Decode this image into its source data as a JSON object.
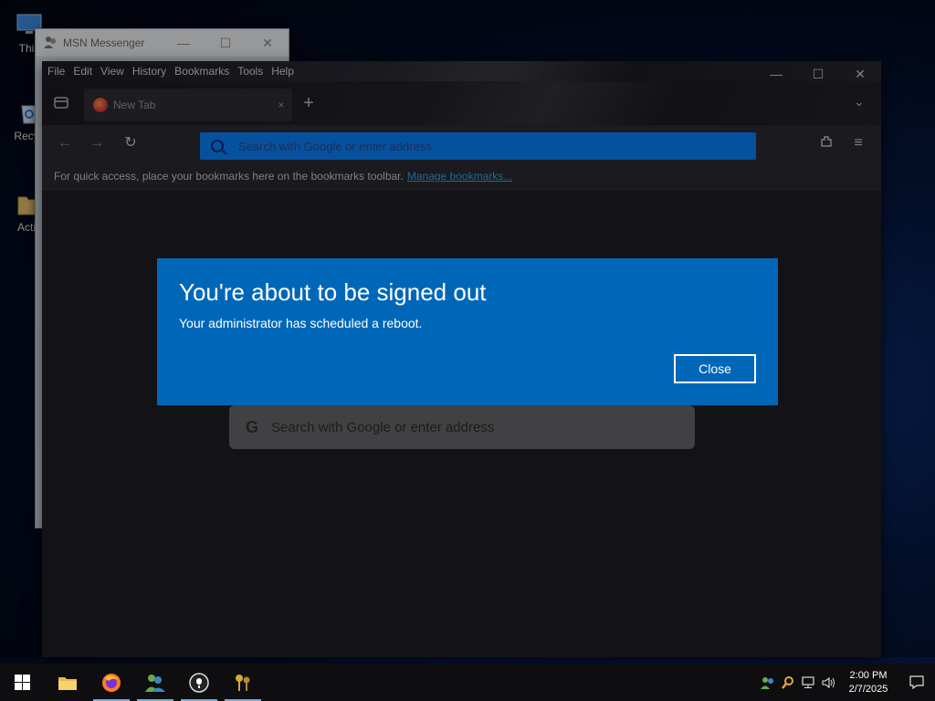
{
  "desktop": {
    "icons": [
      {
        "label": "This",
        "icon": "monitor-icon"
      },
      {
        "label": "Recyc",
        "icon": "recycle-bin-icon"
      },
      {
        "label": "Activ",
        "icon": "folder-icon"
      }
    ]
  },
  "msn_window": {
    "title": "MSN Messenger",
    "controls": {
      "minimize": "—",
      "maximize": "☐",
      "close": "✕"
    }
  },
  "firefox": {
    "menu": [
      "File",
      "Edit",
      "View",
      "History",
      "Bookmarks",
      "Tools",
      "Help"
    ],
    "tab": {
      "label": "New Tab",
      "close": "×"
    },
    "new_tab_plus": "+",
    "url_placeholder": "Search with Google or enter address",
    "bookmarks_bar": {
      "text": "For quick access, place your bookmarks here on the bookmarks toolbar.",
      "link": "Manage bookmarks..."
    },
    "content_search": {
      "g": "G",
      "placeholder": "Search with Google or enter address"
    }
  },
  "dialog": {
    "title": "You're about to be signed out",
    "message": "Your administrator has scheduled a reboot.",
    "close_label": "Close"
  },
  "taskbar": {
    "apps": [
      "file-explorer-icon",
      "firefox-icon",
      "msn-messenger-icon",
      "lightbulb-app-icon",
      "keys-app-icon"
    ],
    "tray": [
      "msn-tray-icon",
      "search-tray-icon",
      "network-icon",
      "volume-icon"
    ],
    "time": "2:00 PM",
    "date": "2/7/2025"
  },
  "colors": {
    "dialog_bg": "#0067b8",
    "url_bar_accent": "#0a84ff",
    "link": "#3aa7e6"
  }
}
